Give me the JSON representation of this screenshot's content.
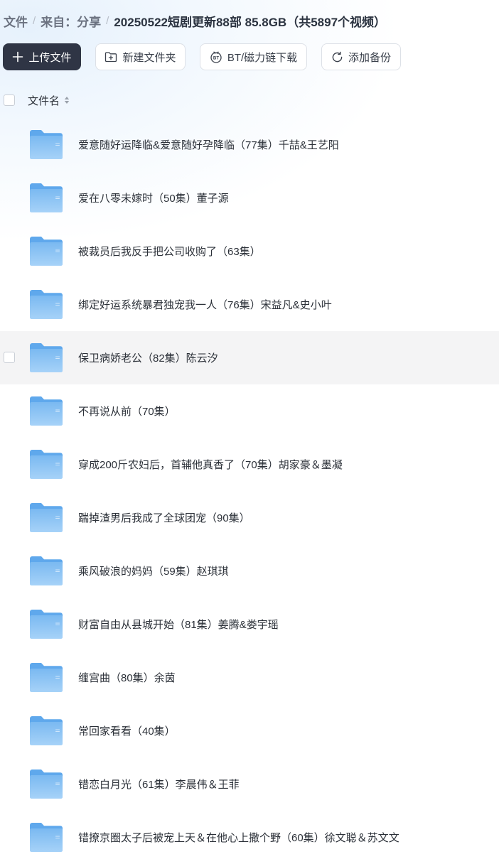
{
  "breadcrumb": {
    "items": [
      "文件",
      "来自：分享"
    ],
    "current": "20250522短剧更新88部 85.8GB（共5897个视频）"
  },
  "toolbar": {
    "upload_label": "上传文件",
    "new_folder_label": "新建文件夹",
    "bt_label": "BT/磁力链下载",
    "backup_label": "添加备份"
  },
  "table": {
    "column_name": "文件名",
    "rows": [
      {
        "name": "爱意随好运降临&爱意随好孕降临（77集）千喆&王艺阳"
      },
      {
        "name": "爱在八零未嫁时（50集）董子源"
      },
      {
        "name": "被裁员后我反手把公司收购了（63集）"
      },
      {
        "name": "绑定好运系统暴君独宠我一人（76集）宋益凡&史小叶"
      },
      {
        "name": "保卫病娇老公（82集）陈云汐"
      },
      {
        "name": "不再说从前（70集）"
      },
      {
        "name": "穿成200斤农妇后，首辅他真香了（70集）胡家豪＆墨凝"
      },
      {
        "name": "踹掉渣男后我成了全球团宠（90集）"
      },
      {
        "name": "乘风破浪的妈妈（59集）赵琪琪"
      },
      {
        "name": "财富自由从县城开始（81集）姜腾&娄宇瑶"
      },
      {
        "name": "缠宫曲（80集）余茵"
      },
      {
        "name": "常回家看看（40集）"
      },
      {
        "name": "错恋白月光（61集）李晨伟＆王菲"
      },
      {
        "name": "错撩京圈太子后被宠上天＆在他心上撒个野（60集）徐文聪＆苏文文"
      }
    ]
  },
  "colors": {
    "primary_button": "#2f3545",
    "folder_top": "#5fa8ec",
    "folder_body": "#8cc4f5",
    "hover_row": "#f4f4f5"
  }
}
